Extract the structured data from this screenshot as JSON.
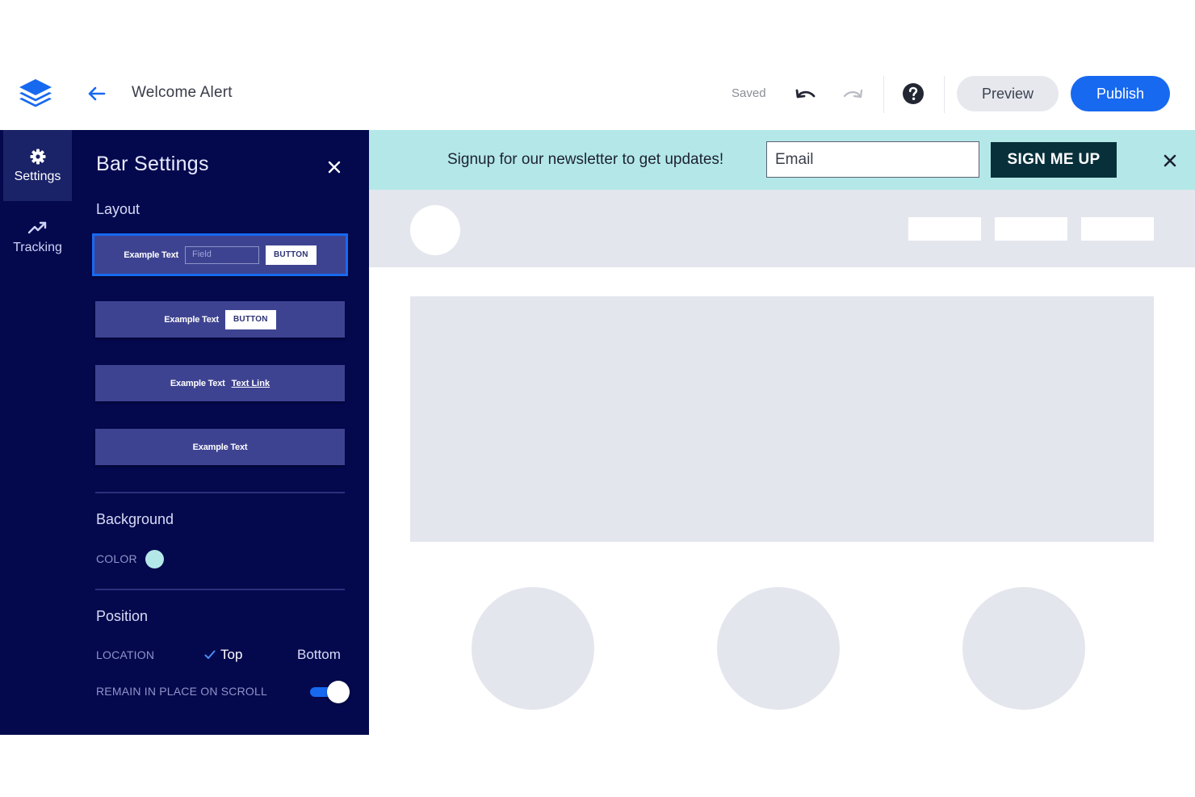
{
  "app": {
    "title": "Welcome Alert",
    "status": "Saved",
    "preview_label": "Preview",
    "publish_label": "Publish"
  },
  "icons": {
    "logo": "layers-logo-icon",
    "back": "arrow-left-icon",
    "undo": "undo-icon",
    "redo": "redo-icon",
    "help": "help-circle-icon",
    "settings": "gear-icon",
    "tracking": "trending-up-icon",
    "close": "close-icon",
    "check": "check-icon"
  },
  "rail": {
    "items": [
      {
        "label": "Settings",
        "icon": "gear-icon",
        "active": true
      },
      {
        "label": "Tracking",
        "icon": "trending-up-icon",
        "active": false
      }
    ]
  },
  "panel": {
    "title": "Bar Settings",
    "layout_label": "Layout",
    "layout_options": [
      {
        "text": "Example Text",
        "field": "Field",
        "button": "BUTTON",
        "selected": true
      },
      {
        "text": "Example Text",
        "button": "BUTTON",
        "selected": false
      },
      {
        "text": "Example Text",
        "link": "Text Link",
        "selected": false
      },
      {
        "text": "Example Text",
        "selected": false
      }
    ],
    "background_label": "Background",
    "color_label": "COLOR",
    "color_value": "#b4e8e8",
    "position_label": "Position",
    "location_label": "LOCATION",
    "location_options": [
      "Top",
      "Bottom"
    ],
    "location_selected": "Top",
    "scroll_label": "REMAIN IN PLACE ON SCROLL",
    "scroll_enabled": true
  },
  "alert_bar": {
    "message": "Signup for our newsletter to get updates!",
    "email_placeholder": "Email",
    "submit_label": "SIGN ME UP",
    "background": "#b4e8e8"
  },
  "colors": {
    "panel_bg": "#04094e",
    "accent": "#1769f0",
    "submit_bg": "#08303a",
    "placeholder_gray": "#e4e6ee"
  }
}
